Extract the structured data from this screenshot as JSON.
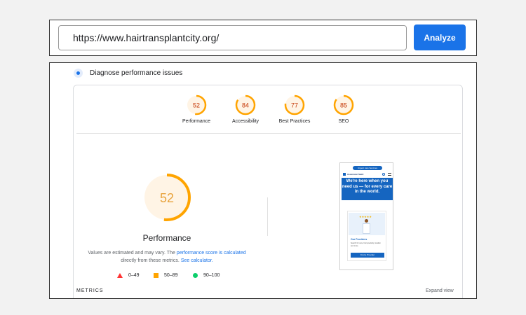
{
  "search": {
    "url_value": "https://www.hairtransplantcity.org/",
    "analyze_label": "Analyze"
  },
  "report": {
    "diagnose_title": "Diagnose performance issues",
    "gauges": [
      {
        "label": "Performance",
        "score": 52,
        "color": "#ffa400"
      },
      {
        "label": "Accessibility",
        "score": 84,
        "color": "#ffa400"
      },
      {
        "label": "Best Practices",
        "score": 77,
        "color": "#ffa400"
      },
      {
        "label": "SEO",
        "score": 85,
        "color": "#ffa400"
      }
    ],
    "main_score": 52,
    "main_title": "Performance",
    "desc_prefix": "Values are estimated and may vary. The",
    "desc_link1": "performance score is calculated",
    "desc_middle": "directly from these metrics.",
    "desc_link2": "See calculator.",
    "legend": [
      {
        "shape": "triangle",
        "color": "#ff3333",
        "range": "0–49"
      },
      {
        "shape": "square",
        "color": "#ffa400",
        "range": "50–89"
      },
      {
        "shape": "circle",
        "color": "#0cce6b",
        "range": "90–100"
      }
    ],
    "metrics_label": "METRICS",
    "expand_label": "Expand view"
  },
  "screenshot": {
    "pill": "Urgent care Services",
    "logo": "Ascension Saint",
    "hero": "We're here when you need us — for every care in the world.",
    "stars": "★★★★★",
    "card_title": "Our Providers",
    "card_text": "Search for care, hair specialty, location and more.",
    "card_button": "Find a Provider"
  },
  "colors": {
    "accent": "#1a73e8",
    "average": "#ffa400",
    "fail": "#ff3333",
    "pass": "#0cce6b"
  }
}
